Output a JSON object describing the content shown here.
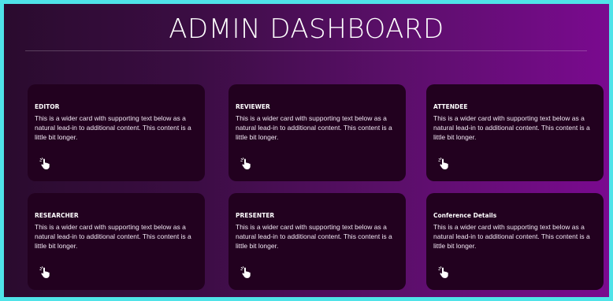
{
  "header": {
    "title": "ADMIN DASHBOARD"
  },
  "cards": [
    {
      "title": "EDITOR",
      "text": "This is a wider card with supporting text below as a natural lead-in to additional content. This content is a little bit longer.",
      "icon": "hand-pointer-icon"
    },
    {
      "title": "REVIEWER",
      "text": "This is a wider card with supporting text below as a natural lead-in to additional content. This content is a little bit longer.",
      "icon": "hand-pointer-icon"
    },
    {
      "title": "ATTENDEE",
      "text": "This is a wider card with supporting text below as a natural lead-in to additional content. This content is a little bit longer.",
      "icon": "hand-pointer-icon"
    },
    {
      "title": "RESEARCHER",
      "text": "This is a wider card with supporting text below as a natural lead-in to additional content. This content is a little bit longer.",
      "icon": "hand-pointer-icon"
    },
    {
      "title": "PRESENTER",
      "text": "This is a wider card with supporting text below as a natural lead-in to additional content. This content is a little bit longer.",
      "icon": "hand-pointer-icon"
    },
    {
      "title": "Conference Details",
      "text": "This is a wider card with supporting text below as a natural lead-in to additional content. This content is a little bit longer.",
      "icon": "hand-pointer-icon"
    }
  ],
  "colors": {
    "page_border": "#4fe3e8",
    "gradient_start": "#2a0b2e",
    "gradient_end": "#7a0a8f",
    "card_background": "#22011f",
    "text": "#ffffff"
  }
}
